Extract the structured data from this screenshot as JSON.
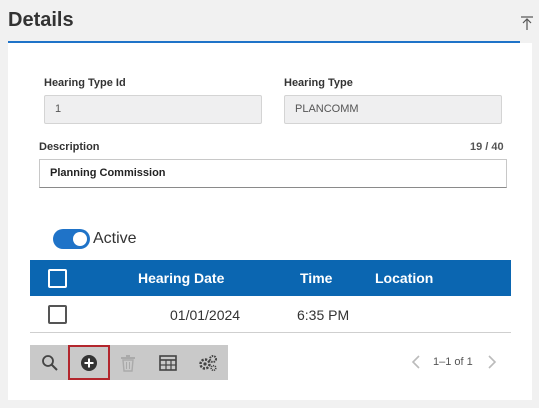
{
  "header": {
    "title": "Details",
    "collapse_icon": "collapse-up-icon"
  },
  "form": {
    "hearing_type_id": {
      "label": "Hearing Type Id",
      "value": "1"
    },
    "hearing_type": {
      "label": "Hearing Type",
      "value": "PLANCOMM"
    },
    "description": {
      "label": "Description",
      "value": "Planning Commission",
      "counter": "19 / 40"
    },
    "active": {
      "label": "Active",
      "checked": true
    }
  },
  "grid": {
    "columns": [
      "Hearing Date",
      "Time",
      "Location"
    ],
    "rows": [
      {
        "hearing_date": "01/01/2024",
        "time": "6:35 PM",
        "location": ""
      }
    ]
  },
  "toolbar": {
    "buttons": [
      "search-icon",
      "add-icon",
      "delete-icon",
      "columns-icon",
      "settings-icon"
    ]
  },
  "pager": {
    "text": "1–1 of 1"
  },
  "colors": {
    "accent": "#1f73c8",
    "grid_header": "#0b66b1",
    "highlight": "#b3262d"
  }
}
